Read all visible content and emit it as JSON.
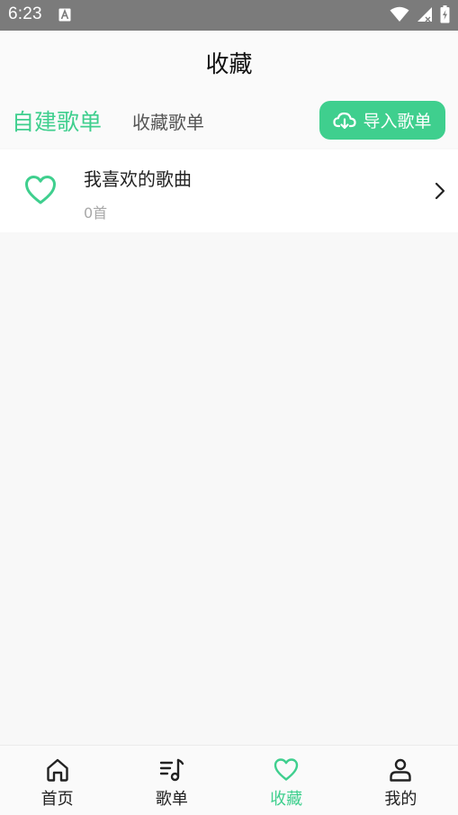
{
  "status_bar": {
    "time": "6:23",
    "notification_icon": "a-icon",
    "icons": [
      "wifi-icon",
      "signal-icon",
      "battery-icon"
    ]
  },
  "header": {
    "title": "收藏"
  },
  "tabs": {
    "self_built": "自建歌单",
    "collected": "收藏歌单"
  },
  "import_button": {
    "icon": "cloud-download-icon",
    "label": "导入歌单"
  },
  "playlists": [
    {
      "icon": "heart-icon",
      "name": "我喜欢的歌曲",
      "count": "0首"
    }
  ],
  "bottom_nav": {
    "items": [
      {
        "icon": "home-icon",
        "label": "首页"
      },
      {
        "icon": "music-list-icon",
        "label": "歌单"
      },
      {
        "icon": "heart-icon",
        "label": "收藏",
        "active": true
      },
      {
        "icon": "user-icon",
        "label": "我的"
      }
    ]
  },
  "colors": {
    "accent": "#3fcf8e",
    "status_bar": "#7b7b7b",
    "background": "#f8f8f8"
  }
}
